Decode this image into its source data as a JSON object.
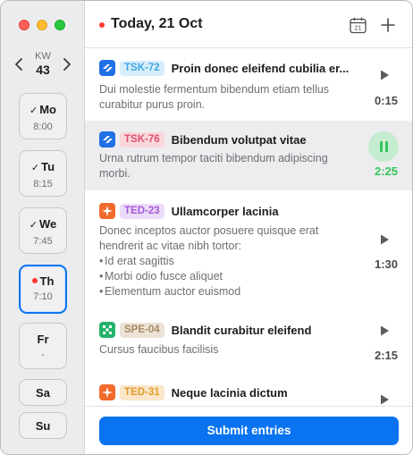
{
  "sidebar": {
    "week_label": "KW",
    "week_number": "43",
    "days": [
      {
        "name": "Mo",
        "time": "8:00",
        "status": "done"
      },
      {
        "name": "Tu",
        "time": "8:15",
        "status": "done"
      },
      {
        "name": "We",
        "time": "7:45",
        "status": "done"
      },
      {
        "name": "Th",
        "time": "7:10",
        "status": "today"
      },
      {
        "name": "Fr",
        "time": "-",
        "status": "none"
      },
      {
        "name": "Sa",
        "status": "none"
      },
      {
        "name": "Su",
        "status": "none"
      }
    ],
    "check_glyph": "✓"
  },
  "header": {
    "title": "Today, 21 Oct",
    "calendar_icon_day": "21"
  },
  "entries": [
    {
      "app": "jira",
      "tag": "TSK-72",
      "title": "Proin donec eleifend cubilia er...",
      "desc": "Dui molestie fermentum bibendum etiam tellus curabitur purus proin.",
      "duration": "0:15",
      "running": false
    },
    {
      "app": "jira",
      "tag": "TSK-76",
      "title": "Bibendum volutpat vitae",
      "desc": "Urna rutrum tempor taciti bibendum adipiscing morbi.",
      "duration": "2:25",
      "running": true
    },
    {
      "app": "asana",
      "tag": "TED-23",
      "title": "Ullamcorper lacinia",
      "desc": "Donec inceptos auctor posuere quisque erat hendrerit ac vitae nibh tortor:",
      "bullets": [
        "Id erat sagittis",
        "Morbi odio fusce aliquet",
        "Elementum auctor euismod"
      ],
      "duration": "1:30",
      "running": false
    },
    {
      "app": "linear",
      "tag": "SPE-04",
      "title": "Blandit curabitur eleifend",
      "desc": "Cursus faucibus facilisis",
      "duration": "2:15",
      "running": false
    },
    {
      "app": "asana",
      "tag": "TED-31",
      "title": "Neque lacinia dictum",
      "running": false
    }
  ],
  "footer": {
    "submit_label": "Submit entries"
  },
  "colors": {
    "accent": "#0a74f0",
    "running": "#34c759",
    "today_dot": "#ff3b30"
  }
}
